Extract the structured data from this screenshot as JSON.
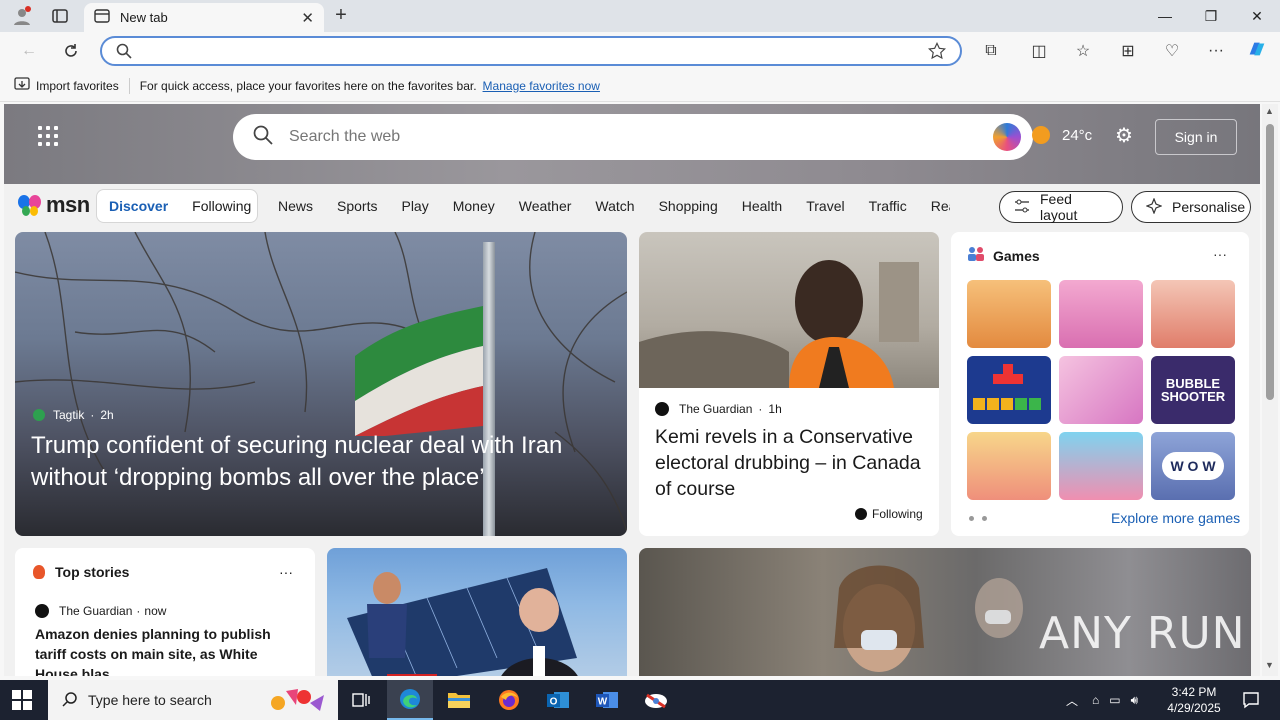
{
  "browser": {
    "tab_title": "New tab",
    "address_value": "",
    "favorites_bar": {
      "import_label": "Import favorites",
      "hint_text": "For quick access, place your favorites here on the favorites bar.",
      "manage_link": "Manage favorites now"
    }
  },
  "msn": {
    "search_placeholder": "Search the web",
    "weather_temp": "24°c",
    "sign_in": "Sign in",
    "logo_text": "msn",
    "feed_tabs": [
      "Discover",
      "Following"
    ],
    "nav_links": [
      "News",
      "Sports",
      "Play",
      "Money",
      "Weather",
      "Watch",
      "Shopping",
      "Health",
      "Travel",
      "Traffic",
      "Real E"
    ],
    "feed_layout": "Feed layout",
    "personalise": "Personalise"
  },
  "hero_story": {
    "source": "Tagtik",
    "age": "2h",
    "headline": "Trump confident of securing nuclear deal with Iran without ‘dropping bombs all over the place’"
  },
  "guardian_story": {
    "source": "The Guardian",
    "age": "1h",
    "headline": "Kemi revels in a Conservative electoral drubbing – in Canada of course",
    "follow_label": "Following"
  },
  "games": {
    "title": "Games",
    "explore": "Explore more games",
    "tile_texts": {
      "bubble": "BUBBLE SHOOTER",
      "wow": "W O W"
    }
  },
  "top_stories": {
    "title": "Top stories",
    "source": "The Guardian",
    "age": "now",
    "headline": "Amazon denies planning to publish tariff costs on main site, as White House blas..."
  },
  "watermark": "ANY RUN",
  "taskbar": {
    "search_placeholder": "Type here to search",
    "time": "3:42 PM",
    "date": "4/29/2025"
  },
  "colors": {
    "accent": "#1a5fb4",
    "taskbar": "#1c2230"
  }
}
